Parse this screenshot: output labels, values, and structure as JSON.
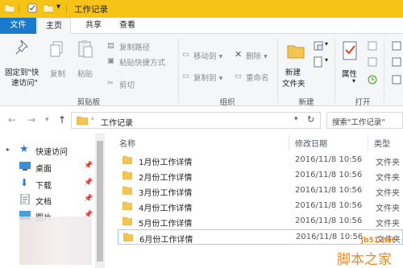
{
  "window": {
    "title": "工作记录"
  },
  "ribbon_tabs": [
    "文件",
    "主页",
    "共享",
    "查看"
  ],
  "ribbon": {
    "clipboard": {
      "pin_label_1": "固定到\"快",
      "pin_label_2": "速访问\"",
      "copy": "复制",
      "paste": "粘贴",
      "copy_path": "复制路径",
      "paste_shortcut": "粘贴快捷方式",
      "cut": "剪切",
      "group": "剪贴板"
    },
    "organize": {
      "move_to": "移动到",
      "copy_to": "复制到",
      "delete": "删除",
      "rename": "重命名",
      "group": "组织"
    },
    "new": {
      "new_folder_1": "新建",
      "new_folder_2": "文件夹",
      "group": "新建"
    },
    "open": {
      "properties": "属性",
      "group": "打开"
    }
  },
  "address": {
    "path": "工作记录",
    "search_placeholder": "搜索\"工作记录\""
  },
  "nav_pane": [
    {
      "label": "快速访问",
      "icon": "star-icon"
    },
    {
      "label": "桌面",
      "icon": "desktop-icon"
    },
    {
      "label": "下载",
      "icon": "download-icon"
    },
    {
      "label": "文档",
      "icon": "document-icon"
    },
    {
      "label": "图片",
      "icon": "pictures-icon"
    }
  ],
  "columns": {
    "name": "名称",
    "date": "修改日期",
    "type": "类型"
  },
  "files": [
    {
      "name": "1月份工作详情",
      "date": "2016/11/8 10:56",
      "type": "文件夹"
    },
    {
      "name": "2月份工作详情",
      "date": "2016/11/8 10:56",
      "type": "文件夹"
    },
    {
      "name": "3月份工作详情",
      "date": "2016/11/8 10:56",
      "type": "文件夹"
    },
    {
      "name": "4月份工作详情",
      "date": "2016/11/8 10:56",
      "type": "文件夹"
    },
    {
      "name": "5月份工作详情",
      "date": "2016/11/8 10:56",
      "type": "文件夹"
    },
    {
      "name": "6月份工作详情",
      "date": "2016/11/8 10:56",
      "type": "文件夹"
    }
  ],
  "watermark": {
    "url": "jb51.net",
    "name": "脚本之家"
  },
  "colors": {
    "titlebar": "#f6c416",
    "file_tab": "#1979ca",
    "folder": "#f5c451",
    "selection": "#99d1ff"
  }
}
